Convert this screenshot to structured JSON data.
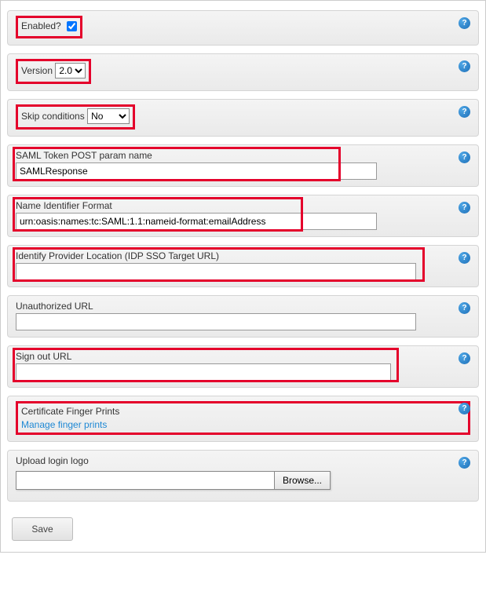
{
  "fields": {
    "enabled": {
      "label": "Enabled?",
      "checked": true
    },
    "version": {
      "label": "Version",
      "value": "2.0",
      "options": [
        "2.0"
      ]
    },
    "skip_conditions": {
      "label": "Skip conditions",
      "value": "No",
      "options": [
        "No"
      ]
    },
    "saml_token": {
      "label": "SAML Token POST param name",
      "value": "SAMLResponse"
    },
    "name_id_format": {
      "label": "Name Identifier Format",
      "value": "urn:oasis:names:tc:SAML:1.1:nameid-format:emailAddress"
    },
    "idp_location": {
      "label": "Identify Provider Location (IDP SSO Target URL)",
      "value": ""
    },
    "unauthorized_url": {
      "label": "Unauthorized URL",
      "value": ""
    },
    "sign_out_url": {
      "label": "Sign out URL",
      "value": ""
    },
    "cert_fingerprints": {
      "label": "Certificate Finger Prints",
      "link": "Manage finger prints"
    },
    "upload_logo": {
      "label": "Upload login logo",
      "browse": "Browse...",
      "path": ""
    }
  },
  "buttons": {
    "save": "Save"
  },
  "help_char": "?"
}
